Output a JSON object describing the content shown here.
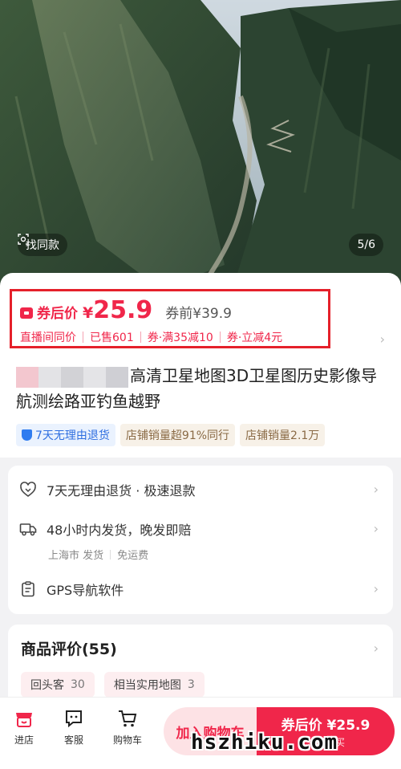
{
  "gallery": {
    "find_similar_label": "找同款",
    "page_indicator": "5/6"
  },
  "price": {
    "after_coupon_label": "券后价",
    "currency": "¥",
    "value": "25.9",
    "before_coupon": "券前¥39.9"
  },
  "promos": [
    "直播间同价",
    "已售601",
    "券·满35减10",
    "券·立减4元"
  ],
  "product": {
    "title_visible": "高清卫星地图3D卫星图历史影像导航测绘路亚钓鱼越野"
  },
  "tags": [
    {
      "label": "7天无理由退货",
      "style": "blue"
    },
    {
      "label": "店铺销量超91%同行",
      "style": "beige"
    },
    {
      "label": "店铺销量2.1万",
      "style": "beige"
    }
  ],
  "services": {
    "returns": "7天无理由退货 · 极速退款",
    "shipping": "48小时内发货，晚发即赔",
    "shipping_from": "上海市 发货",
    "shipping_fee": "免运费",
    "spec": "GPS导航软件"
  },
  "reviews": {
    "title": "商品评价(55)",
    "tags": [
      {
        "label": "回头客",
        "count": "30"
      },
      {
        "label": "相当实用地图",
        "count": "3"
      }
    ]
  },
  "bottom_bar": {
    "store": "进店",
    "service": "客服",
    "cart": "购物车",
    "add_to_cart": "加入购物车",
    "buy_main": "券后价 ¥25.9",
    "buy_sub": "领券购买"
  },
  "watermark": "hszhiku.com",
  "colors": {
    "accent": "#f0264a",
    "highlight_box": "#e5202a",
    "tag_blue": "#2f6fe0"
  }
}
